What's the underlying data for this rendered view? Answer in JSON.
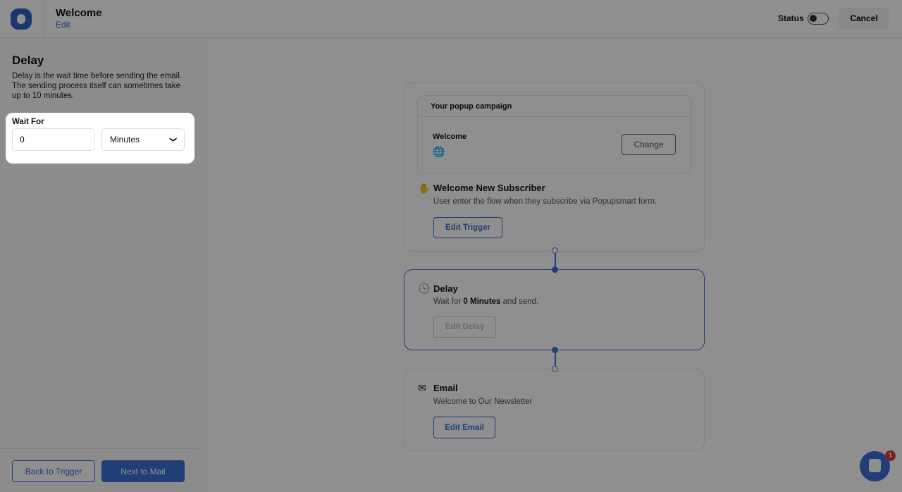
{
  "header": {
    "title": "Welcome",
    "edit_link": "Edit",
    "status_label": "Status",
    "status_on": false,
    "cancel_label": "Cancel"
  },
  "sidebar": {
    "title": "Delay",
    "description": "Delay is the wait time before sending the email. The sending process itself can sometimes take up to 10 minutes.",
    "wait_for_label": "Wait For",
    "wait_value": "0",
    "unit_value": "Minutes",
    "back_label": "Back to Trigger",
    "next_label": "Next to Mail"
  },
  "flow": {
    "campaign": {
      "header": "Your popup campaign",
      "name": "Welcome",
      "change_label": "Change"
    },
    "trigger": {
      "title": "Welcome New Subscriber",
      "description": "User enter the flow when they subscribe via Popupsmart form.",
      "button": "Edit Trigger",
      "icon": "waving-hand-icon"
    },
    "delay": {
      "title": "Delay",
      "desc_prefix": "Wait for",
      "desc_value": "0 Minutes",
      "desc_suffix": "and send.",
      "button": "Edit Delay",
      "icon": "clock-icon"
    },
    "email": {
      "title": "Email",
      "description": "Welcome to Our Newsletter",
      "button": "Edit Email",
      "icon": "mail-send-icon"
    }
  },
  "chat": {
    "badge": "1"
  },
  "colors": {
    "accent": "#3b6fd4",
    "badge": "#d93a3a"
  }
}
